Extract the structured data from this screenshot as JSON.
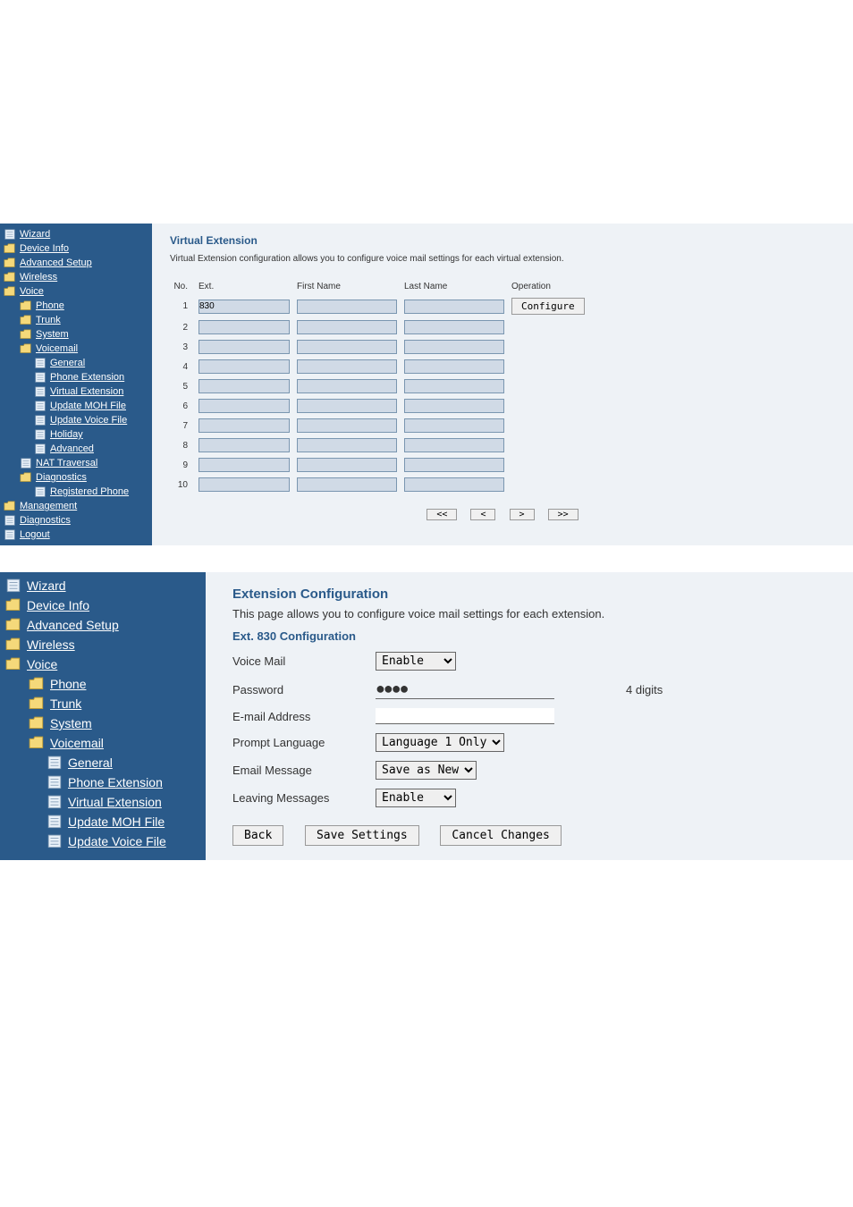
{
  "sidebar1": {
    "items": [
      {
        "label": "Wizard",
        "icon": "page",
        "indent": 0
      },
      {
        "label": "Device Info",
        "icon": "folder",
        "indent": 0
      },
      {
        "label": "Advanced Setup",
        "icon": "folder",
        "indent": 0
      },
      {
        "label": "Wireless",
        "icon": "folder",
        "indent": 0
      },
      {
        "label": "Voice",
        "icon": "folder",
        "indent": 0
      },
      {
        "label": "Phone",
        "icon": "folder",
        "indent": 1
      },
      {
        "label": "Trunk",
        "icon": "folder",
        "indent": 1
      },
      {
        "label": "System",
        "icon": "folder",
        "indent": 1
      },
      {
        "label": "Voicemail",
        "icon": "folder",
        "indent": 1
      },
      {
        "label": "General",
        "icon": "page",
        "indent": 2
      },
      {
        "label": "Phone Extension",
        "icon": "page",
        "indent": 2
      },
      {
        "label": "Virtual Extension",
        "icon": "page",
        "indent": 2
      },
      {
        "label": "Update MOH File",
        "icon": "page",
        "indent": 2
      },
      {
        "label": "Update Voice File",
        "icon": "page",
        "indent": 2
      },
      {
        "label": "Holiday",
        "icon": "page",
        "indent": 2
      },
      {
        "label": "Advanced",
        "icon": "page",
        "indent": 2
      },
      {
        "label": "NAT Traversal",
        "icon": "page",
        "indent": 1
      },
      {
        "label": "Diagnostics",
        "icon": "folder",
        "indent": 1
      },
      {
        "label": "Registered Phone",
        "icon": "page",
        "indent": 2
      },
      {
        "label": "Management",
        "icon": "folder",
        "indent": 0
      },
      {
        "label": "Diagnostics",
        "icon": "page",
        "indent": 0
      },
      {
        "label": "Logout",
        "icon": "page",
        "indent": 0
      }
    ]
  },
  "panel1": {
    "title": "Virtual Extension",
    "desc": "Virtual Extension configuration allows you to configure voice mail settings for each virtual extension.",
    "headers": {
      "no": "No.",
      "ext": "Ext.",
      "first": "First Name",
      "last": "Last Name",
      "op": "Operation"
    },
    "rows": [
      {
        "no": "1",
        "ext": "830",
        "first": "",
        "last": "",
        "op": "Configure"
      },
      {
        "no": "2",
        "ext": "",
        "first": "",
        "last": "",
        "op": ""
      },
      {
        "no": "3",
        "ext": "",
        "first": "",
        "last": "",
        "op": ""
      },
      {
        "no": "4",
        "ext": "",
        "first": "",
        "last": "",
        "op": ""
      },
      {
        "no": "5",
        "ext": "",
        "first": "",
        "last": "",
        "op": ""
      },
      {
        "no": "6",
        "ext": "",
        "first": "",
        "last": "",
        "op": ""
      },
      {
        "no": "7",
        "ext": "",
        "first": "",
        "last": "",
        "op": ""
      },
      {
        "no": "8",
        "ext": "",
        "first": "",
        "last": "",
        "op": ""
      },
      {
        "no": "9",
        "ext": "",
        "first": "",
        "last": "",
        "op": ""
      },
      {
        "no": "10",
        "ext": "",
        "first": "",
        "last": "",
        "op": ""
      }
    ],
    "pager": {
      "first": "<<",
      "prev": "<",
      "next": ">",
      "last": ">>"
    }
  },
  "sidebar2": {
    "items": [
      {
        "label": "Wizard",
        "icon": "page",
        "indent": 0
      },
      {
        "label": "Device Info",
        "icon": "folder",
        "indent": 0
      },
      {
        "label": "Advanced Setup",
        "icon": "folder",
        "indent": 0
      },
      {
        "label": "Wireless",
        "icon": "folder",
        "indent": 0
      },
      {
        "label": "Voice",
        "icon": "folder",
        "indent": 0
      },
      {
        "label": "Phone",
        "icon": "folder",
        "indent": 1
      },
      {
        "label": "Trunk",
        "icon": "folder",
        "indent": 1
      },
      {
        "label": "System",
        "icon": "folder",
        "indent": 1
      },
      {
        "label": "Voicemail",
        "icon": "folder",
        "indent": 1
      },
      {
        "label": "General",
        "icon": "page",
        "indent": 2
      },
      {
        "label": "Phone Extension",
        "icon": "page",
        "indent": 2
      },
      {
        "label": "Virtual Extension",
        "icon": "page",
        "indent": 2
      },
      {
        "label": "Update MOH File",
        "icon": "page",
        "indent": 2
      },
      {
        "label": "Update Voice File",
        "icon": "page",
        "indent": 2
      }
    ]
  },
  "panel2": {
    "title": "Extension Configuration",
    "desc": "This page allows you to configure voice mail settings for each extension.",
    "subtitle": "Ext. 830 Configuration",
    "fields": {
      "voicemail": {
        "label": "Voice Mail",
        "value": "Enable"
      },
      "password": {
        "label": "Password",
        "hint": "4 digits",
        "dots": "●●●●"
      },
      "email": {
        "label": "E-mail Address",
        "value": ""
      },
      "prompt": {
        "label": "Prompt Language",
        "value": "Language 1 Only"
      },
      "emailmsg": {
        "label": "Email Message",
        "value": "Save as New"
      },
      "leaving": {
        "label": "Leaving Messages",
        "value": "Enable"
      }
    },
    "buttons": {
      "back": "Back",
      "save": "Save Settings",
      "cancel": "Cancel Changes"
    }
  }
}
